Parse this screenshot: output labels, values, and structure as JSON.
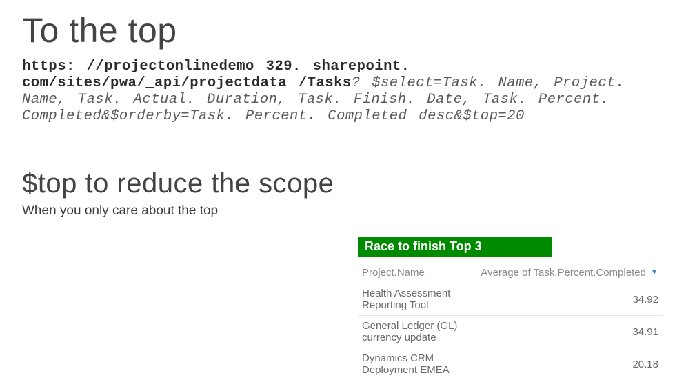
{
  "title": "To the top",
  "url": {
    "bold_part": "https: //projectonlinedemo 329. sharepoint. com/sites/pwa/_api/projectdata /Tasks",
    "italic_part": "? $select=Task. Name, Project. Name, Task. Actual. Duration, Task. Finish. Date, Task. Percent. Completed&$orderby=Task. Percent. Completed desc&$top=20"
  },
  "subheading": "$top to reduce the scope",
  "body_text": "When you only care about the top",
  "chart_data": {
    "type": "table",
    "title": "Race to finish Top 3",
    "columns": [
      "Project.Name",
      "Average of Task.Percent.Completed"
    ],
    "sort_indicator": "▼",
    "rows": [
      {
        "name": "Health Assessment Reporting Tool",
        "value": "34.92"
      },
      {
        "name": "General Ledger (GL) currency update",
        "value": "34.91"
      },
      {
        "name": "Dynamics CRM Deployment EMEA",
        "value": "20.18"
      }
    ]
  }
}
